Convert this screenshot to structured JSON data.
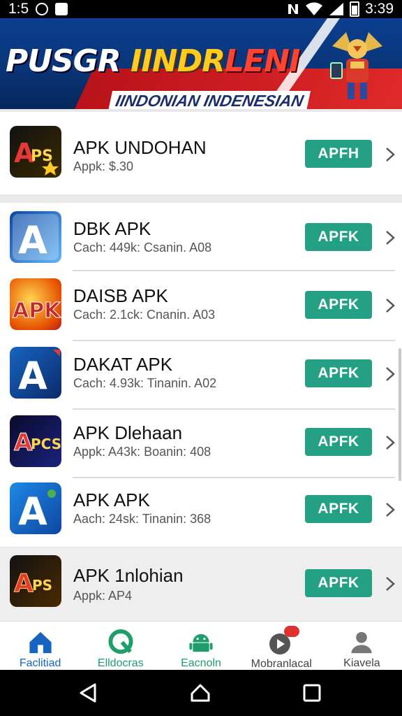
{
  "status_bar": {
    "time_left": "1:5",
    "time_right": "3:39"
  },
  "banner": {
    "title_part1": "PUSGR",
    "title_part2": "IINDR",
    "title_part3": "LENI",
    "subtitle": "IINDONIAN INDENESIAN"
  },
  "apps": [
    {
      "name": "APK UNDOHAN",
      "meta": "Appk: $.30",
      "button": "APFH"
    },
    {
      "name": "DBK APK",
      "meta": "Cach: 449k: Csanin. A08",
      "button": "APFK"
    },
    {
      "name": "DAISB APK",
      "meta": "Cach: 2.1ck: Cnanin. A03",
      "button": "APFK"
    },
    {
      "name": "DAKAT APK",
      "meta": "Cach: 4.93k: Tinanin. A02",
      "button": "APFK"
    },
    {
      "name": "APK Dlehaan",
      "meta": "Appk: A43k: Boanin: 408",
      "button": "APFK"
    },
    {
      "name": "APK APK",
      "meta": "Aach: 24sk: Tinanin: 368",
      "button": "APFK"
    },
    {
      "name": "APK 1nlohian",
      "meta": "Appk: AP4",
      "button": "APFK"
    }
  ],
  "bottom_nav": [
    {
      "label": "Faclitiad",
      "icon": "home-icon",
      "color": "#1565c0"
    },
    {
      "label": "Elldocras",
      "icon": "leaf-icon",
      "color": "#1e9e6a"
    },
    {
      "label": "Eacnoln",
      "icon": "android-icon",
      "color": "#1e9e6a"
    },
    {
      "label": "Mobranlacal",
      "icon": "play-icon",
      "color": "#444444"
    },
    {
      "label": "Kiavela",
      "icon": "person-icon",
      "color": "#444444"
    }
  ],
  "colors": {
    "accent": "#24a084",
    "banner_blue": "#0b3f91",
    "banner_red": "#e02a2a"
  }
}
